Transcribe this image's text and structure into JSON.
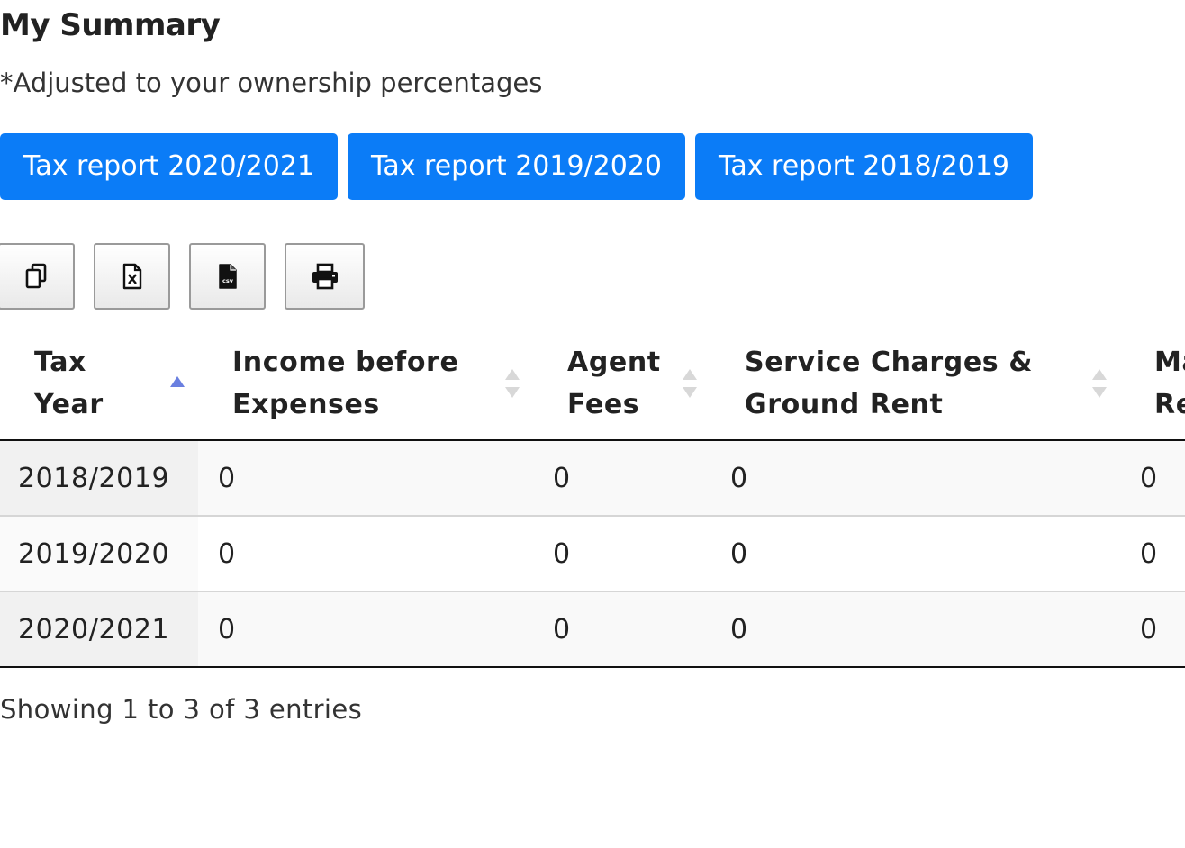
{
  "page": {
    "title": "My Summary",
    "subtitle": "*Adjusted to your ownership percentages"
  },
  "report_buttons": [
    {
      "label": "Tax report 2020/2021"
    },
    {
      "label": "Tax report 2019/2020"
    },
    {
      "label": "Tax report 2018/2019"
    }
  ],
  "export_buttons": [
    {
      "icon": "copy-icon"
    },
    {
      "icon": "excel-file-icon"
    },
    {
      "icon": "csv-file-icon"
    },
    {
      "icon": "print-icon"
    }
  ],
  "table": {
    "columns": [
      {
        "line1": "Tax",
        "line2": "Year",
        "sort": "ascending"
      },
      {
        "line1": "Income before",
        "line2": "Expenses",
        "sort": "none"
      },
      {
        "line1": "Agent",
        "line2": "Fees",
        "sort": "none"
      },
      {
        "line1": "Service Charges &",
        "line2": "Ground Rent",
        "sort": "none"
      },
      {
        "line1": "Ma",
        "line2": "Re",
        "sort": "none"
      }
    ],
    "rows": [
      {
        "year": "2018/2019",
        "income": "0",
        "agent": "0",
        "service": "0",
        "maint": "0"
      },
      {
        "year": "2019/2020",
        "income": "0",
        "agent": "0",
        "service": "0",
        "maint": "0"
      },
      {
        "year": "2020/2021",
        "income": "0",
        "agent": "0",
        "service": "0",
        "maint": "0"
      }
    ],
    "info": "Showing 1 to 3 of 3 entries"
  },
  "colors": {
    "button_primary": "#0b7cf7",
    "sort_active": "#6a7fe0",
    "sort_inactive": "#d8d8d8"
  }
}
